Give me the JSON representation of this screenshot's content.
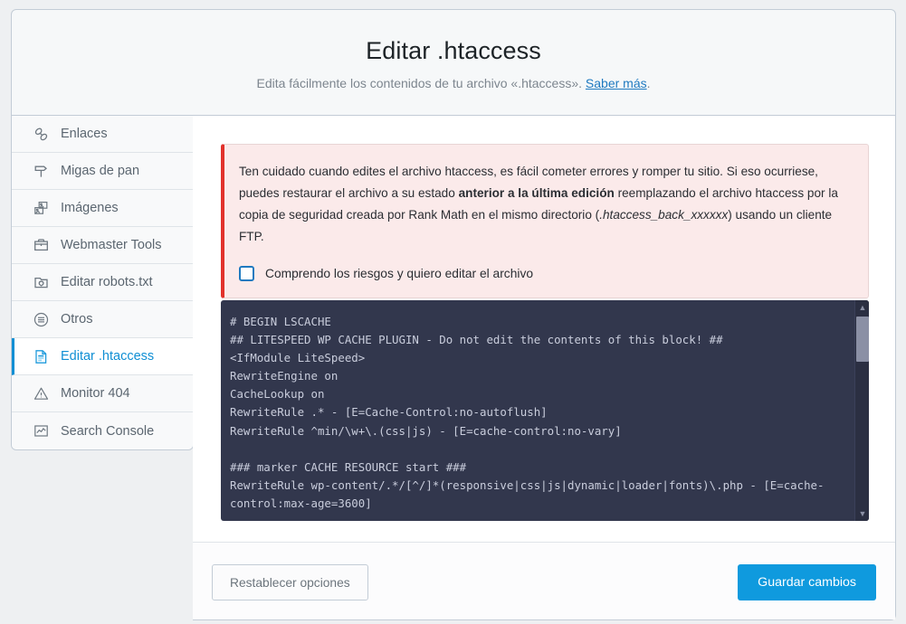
{
  "header": {
    "title": "Editar .htaccess",
    "subtitle_before": "Edita fácilmente los contenidos de tu archivo «.htaccess». ",
    "link_label": "Saber más",
    "subtitle_after": "."
  },
  "sidebar": {
    "items": [
      {
        "label": "Enlaces",
        "icon": "link-icon",
        "active": false
      },
      {
        "label": "Migas de pan",
        "icon": "breadcrumb-signpost-icon",
        "active": false
      },
      {
        "label": "Imágenes",
        "icon": "images-icon",
        "active": false
      },
      {
        "label": "Webmaster Tools",
        "icon": "toolbox-icon",
        "active": false
      },
      {
        "label": "Editar robots.txt",
        "icon": "robots-folder-icon",
        "active": false
      },
      {
        "label": "Otros",
        "icon": "list-circle-icon",
        "active": false
      },
      {
        "label": "Editar .htaccess",
        "icon": "document-lines-icon",
        "active": true
      },
      {
        "label": "Monitor 404",
        "icon": "warning-triangle-icon",
        "active": false
      },
      {
        "label": "Search Console",
        "icon": "chart-box-icon",
        "active": false
      }
    ]
  },
  "notice": {
    "text_part1": "Ten cuidado cuando edites el archivo htaccess, es fácil cometer errores y romper tu sitio. Si eso ocurriese, puedes restaurar el archivo a su estado ",
    "text_bold": "anterior a la última edición",
    "text_part2": " reemplazando el archivo htaccess por la copia de seguridad creada por Rank Math en el mismo directorio (",
    "text_italic": ".htaccess_back_xxxxxx",
    "text_part3": ") usando un cliente FTP.",
    "checkbox_label": "Comprendo los riesgos y quiero editar el archivo",
    "checkbox_checked": false,
    "accent_color": "#e2322c",
    "background_color": "#fbeaea"
  },
  "editor": {
    "content": "# BEGIN LSCACHE\n## LITESPEED WP CACHE PLUGIN - Do not edit the contents of this block! ##\n<IfModule LiteSpeed>\nRewriteEngine on\nCacheLookup on\nRewriteRule .* - [E=Cache-Control:no-autoflush]\nRewriteRule ^min/\\w+\\.(css|js) - [E=cache-control:no-vary]\n\n### marker CACHE RESOURCE start ###\nRewriteRule wp-content/.*/[^/]*(responsive|css|js|dynamic|loader|fonts)\\.php - [E=cache-control:max-age=3600]",
    "background_color": "#32374d",
    "text_color": "#c9cddc",
    "scrollbar_up_glyph": "▲",
    "scrollbar_down_glyph": "▼"
  },
  "footer": {
    "reset_label": "Restablecer opciones",
    "save_label": "Guardar cambios",
    "save_color": "#0f9ade"
  }
}
